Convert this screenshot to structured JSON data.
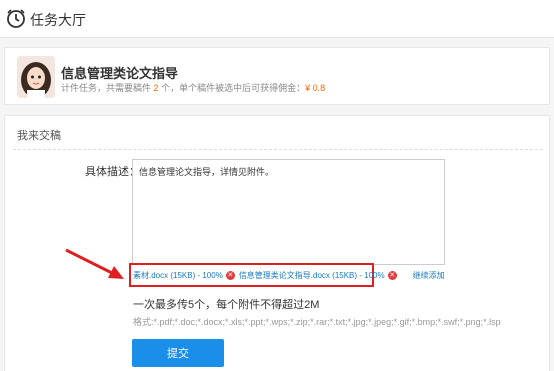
{
  "header": {
    "title": "任务大厅"
  },
  "task": {
    "title": "信息管理类论文指导",
    "meta_prefix": "计件任务，共需要稿件",
    "count": "2",
    "meta_mid": "个，单个稿件被选中后可获得佣金：",
    "reward": "¥ 0.8"
  },
  "submit": {
    "section_title": "我来交稿",
    "desc_label": "具体描述：",
    "desc_value": "信息管理论文指导，详情见附件。",
    "attachments": [
      {
        "name": "素材.docx (15KB) - 100%"
      },
      {
        "name": "信息管理类论文指导.docx (15KB) - 100%"
      }
    ],
    "continue_label": "继续添加",
    "limit_text": "一次最多传5个，每个附件不得超过2M",
    "format_text": "格式:*.pdf;*.doc;*.docx;*.xls;*.ppt;*.wps;*.zip;*.rar;*.txt;*.jpg;*.jpeg;*.gif;*.bmp;*.swf;*.png;*.lsp",
    "submit_label": "提交"
  },
  "colors": {
    "accent": "#1a8ee8",
    "highlight": "#e02020",
    "reward": "#ff6600"
  }
}
